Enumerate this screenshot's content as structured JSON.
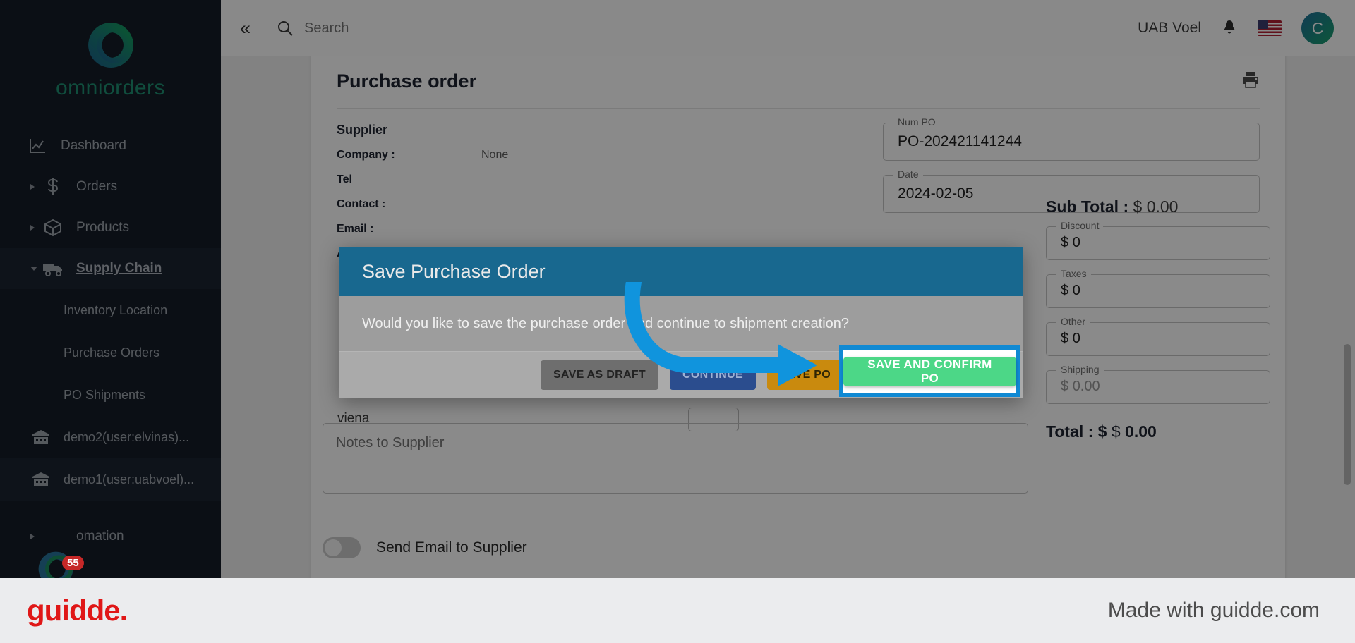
{
  "brand": {
    "name": "omniorders",
    "accent": "#1f8f72"
  },
  "sidebar": {
    "items": [
      {
        "label": "Dashboard",
        "icon": "chart-line-icon",
        "caret": false
      },
      {
        "label": "Orders",
        "icon": "dollar-icon",
        "caret": true
      },
      {
        "label": "Products",
        "icon": "box-icon",
        "caret": true
      },
      {
        "label": "Supply Chain",
        "icon": "truck-icon",
        "caret": true,
        "active": true
      }
    ],
    "sub_items": [
      {
        "label": "Inventory Location"
      },
      {
        "label": "Purchase Orders"
      },
      {
        "label": "PO Shipments"
      }
    ],
    "locations": [
      {
        "label": "demo2(user:elvinas)...",
        "icon": "warehouse-icon"
      },
      {
        "label": "demo1(user:uabvoel)...",
        "icon": "warehouse-icon"
      }
    ],
    "automation": {
      "label": "omation",
      "badge": "55"
    }
  },
  "topbar": {
    "collapse_icon": "double-chevron-left-icon",
    "search": {
      "placeholder": "Search",
      "value": "",
      "icon": "search-icon"
    },
    "company": "UAB Voel",
    "bell_icon": "bell-icon",
    "flag_icon": "us-flag-icon",
    "avatar_initial": "C"
  },
  "page": {
    "title": "Purchase order",
    "print_icon": "printer-icon",
    "supplier": {
      "heading": "Supplier",
      "rows": [
        {
          "key": "Company :",
          "value": "None"
        },
        {
          "key": "Tel",
          "value": ""
        },
        {
          "key": "Contact :",
          "value": ""
        },
        {
          "key": "Email :",
          "value": ""
        },
        {
          "key": "Address:",
          "value": ""
        }
      ]
    },
    "fields": [
      {
        "label": "Num PO",
        "value": "PO-202421141244"
      },
      {
        "label": "Date",
        "value": "2024-02-05"
      }
    ],
    "totals": {
      "sub_total_label": "Sub Total :",
      "sub_total_currency": "$",
      "sub_total_value": "0.00",
      "inputs": [
        {
          "label": "Discount",
          "currency": "$",
          "value": "0",
          "placeholder": false
        },
        {
          "label": "Taxes",
          "currency": "$",
          "value": "0",
          "placeholder": false
        },
        {
          "label": "Other",
          "currency": "$",
          "value": "0",
          "placeholder": false
        },
        {
          "label": "Shipping",
          "currency": "$",
          "value": "0.00",
          "placeholder": true
        }
      ],
      "total_label": "Total : $",
      "total_currency": "$",
      "total_value": "0.00"
    },
    "behind_text": "viena",
    "notes_placeholder": "Notes to Supplier",
    "notes_value": "",
    "email_toggle": {
      "label": "Send Email to Supplier",
      "on": false
    }
  },
  "modal": {
    "title": "Save Purchase Order",
    "message": "Would you like to save the purchase order and continue to shipment creation?",
    "buttons": [
      {
        "label": "SAVE AS DRAFT",
        "style": "draft"
      },
      {
        "label": "CONTINUE",
        "style": "cont"
      },
      {
        "label": "SAVE PO",
        "style": "savepo"
      }
    ],
    "highlighted_button": {
      "label": "SAVE AND CONFIRM PO",
      "color": "#4cd787",
      "highlight_color": "#1089d3"
    }
  },
  "footer": {
    "logo": "guidde.",
    "text": "Made with guidde.com",
    "logo_color": "#e01717"
  }
}
